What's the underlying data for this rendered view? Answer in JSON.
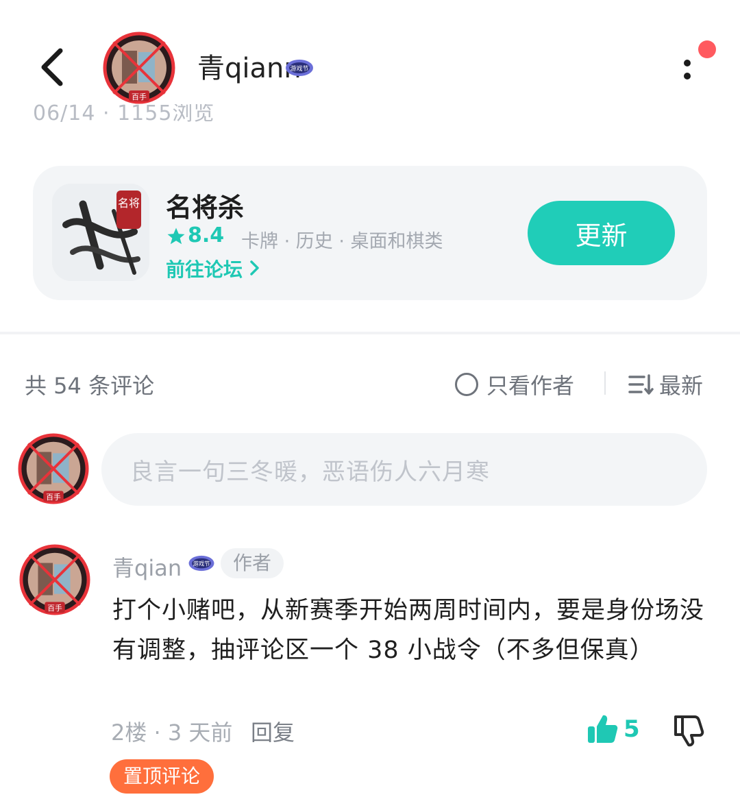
{
  "header": {
    "username": "青qiann",
    "badge_text": "游戏节",
    "meta_partial": "06/14 · 1155浏览"
  },
  "app_card": {
    "name": "名将杀",
    "icon_text": "名将",
    "rating": "8.4",
    "tags": "卡牌 · 历史 · 桌面和棋类",
    "forum_link": "前往论坛",
    "update_label": "更新"
  },
  "comments_bar": {
    "count_label": "共 54 条评论",
    "author_only_label": "只看作者",
    "sort_label": "最新"
  },
  "comment_input": {
    "placeholder": "良言一句三冬暖，恶语伤人六月寒"
  },
  "comment": {
    "author": "青qian",
    "author_tag": "作者",
    "body": "打个小赌吧，从新赛季开始两周时间内，要是身份场没有调整，抽评论区一个 38 小战令（不多但保真）",
    "floor_time": "2楼 · 3 天前",
    "reply_label": "回复",
    "likes": "5",
    "pinned_label": "置顶评论"
  },
  "avatar_badge_text": "百手",
  "colors": {
    "accent": "#20cdb8",
    "pinned": "#ff6f3c",
    "notification": "#ff5a5f",
    "avatar_ring": "#e8333a"
  }
}
